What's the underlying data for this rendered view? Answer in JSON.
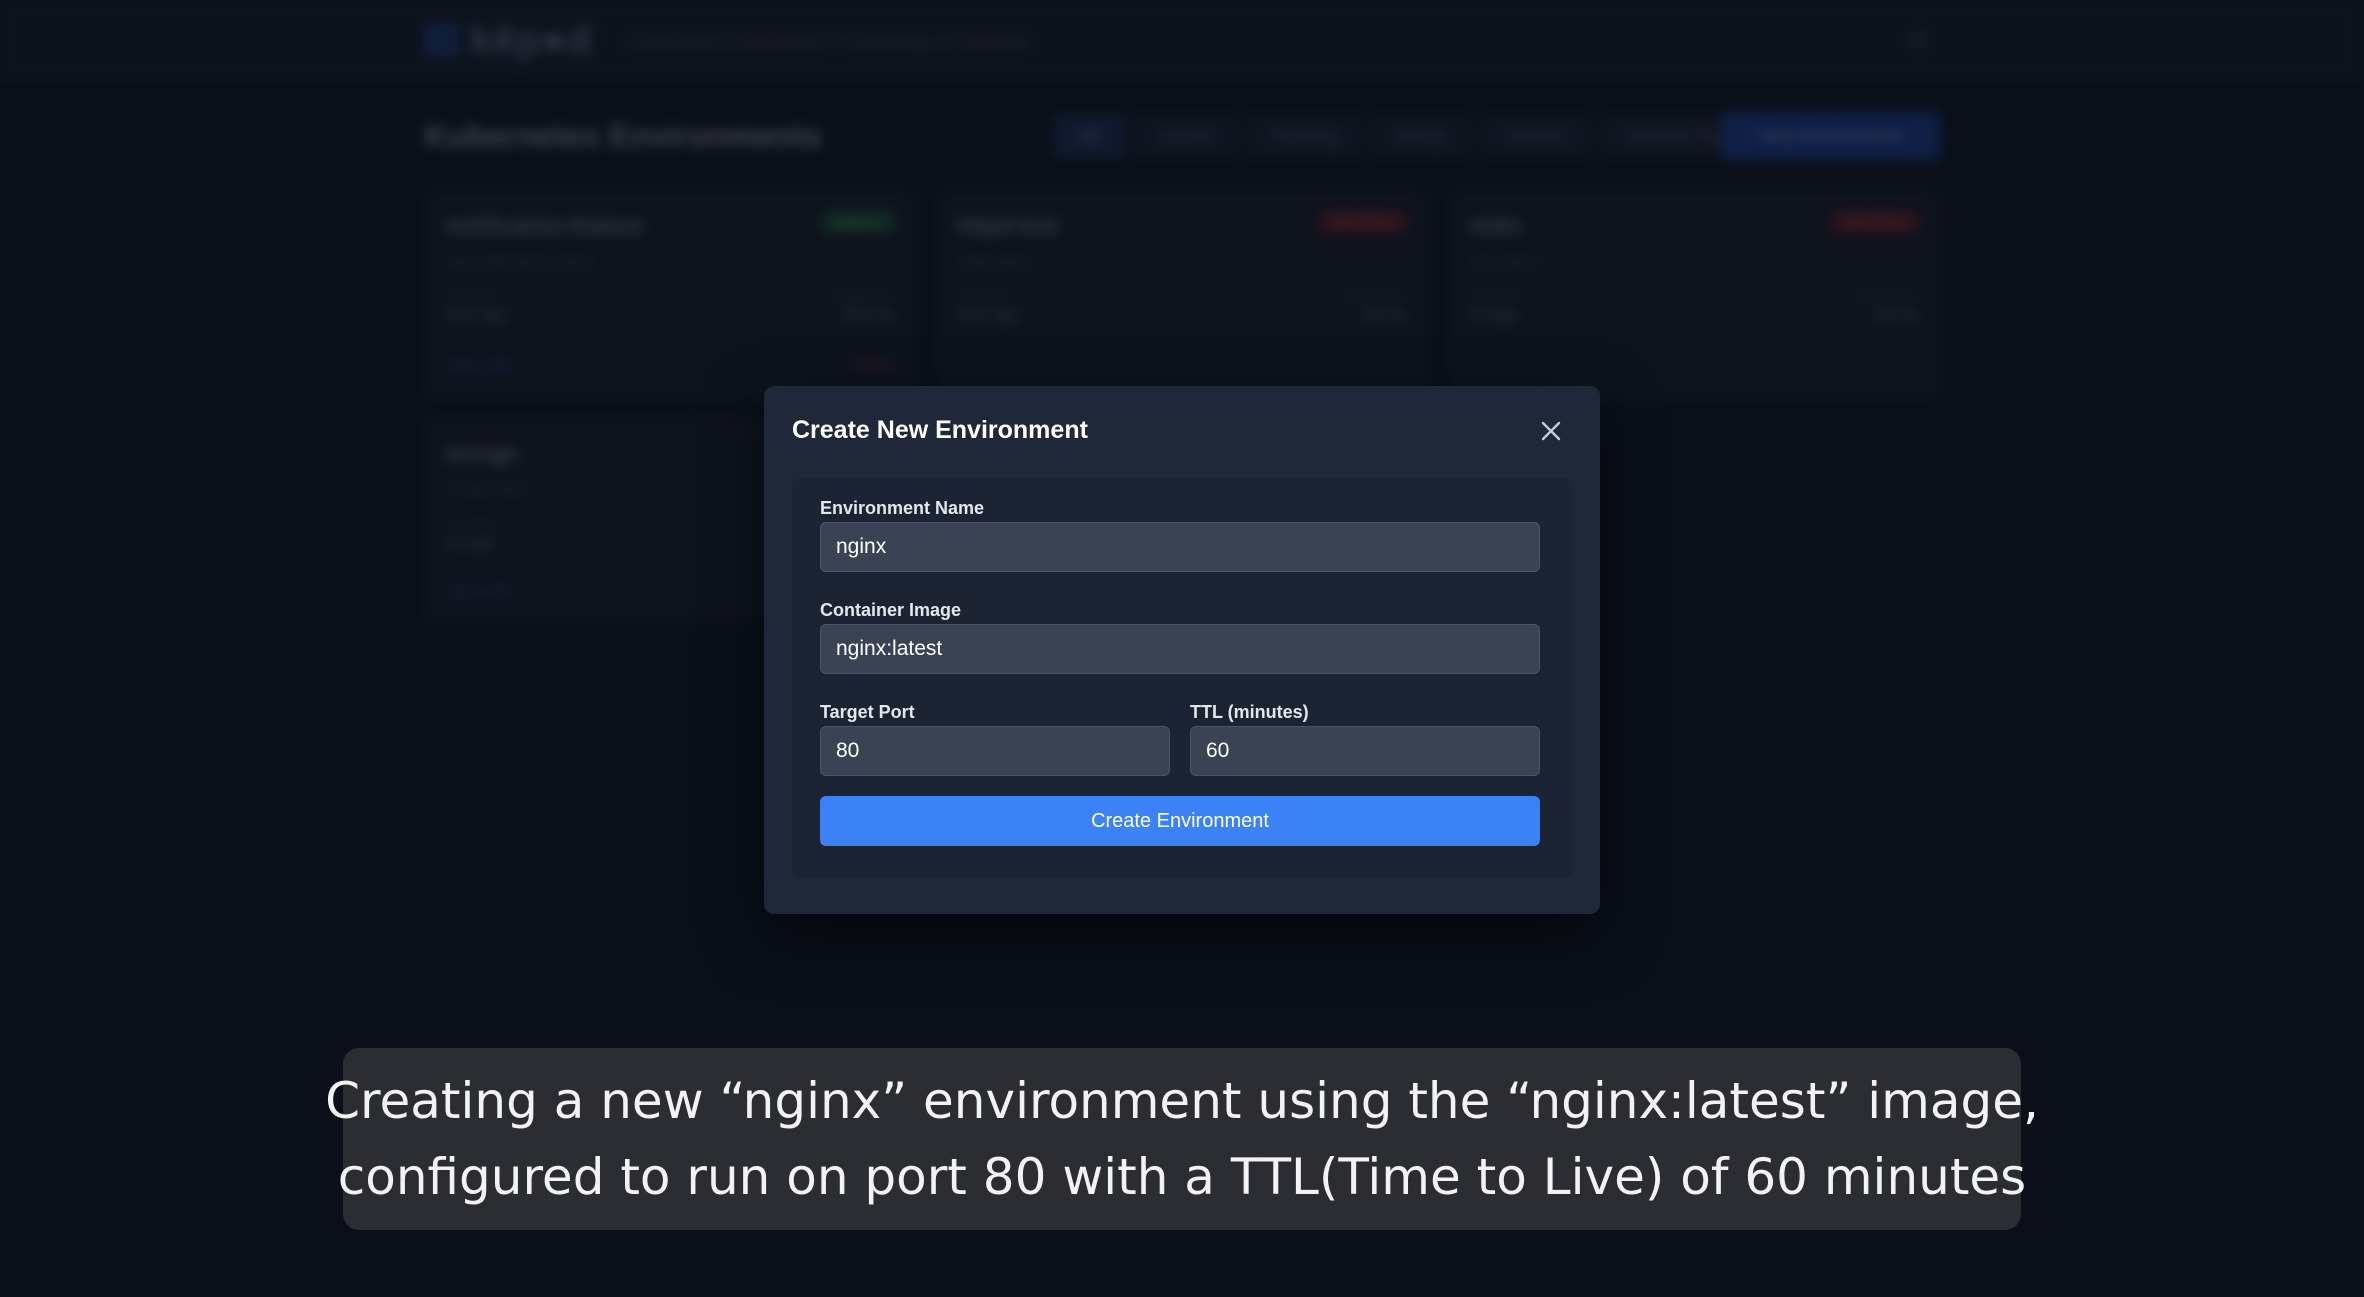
{
  "app": {
    "logo": "kēp●d",
    "tagline": "Kubernetes Environment Provisioning on Demand"
  },
  "page": {
    "title": "Kubernetes Environments",
    "filters": [
      "All",
      "Scaled",
      "Pending",
      "Ready",
      "Deleted"
    ],
    "network_pod_label": "Network Pod",
    "new_environment_label": "New Environment"
  },
  "cards": [
    {
      "title": "notification-feature",
      "subtitle": "app-notifications:latest",
      "status": "READY",
      "created_label": "Created",
      "created": "15m ago",
      "expires_label": "Expires in",
      "expires": "45m 0s",
      "link": "Open URL",
      "danger": "Delete"
    },
    {
      "title": "httpd-test",
      "subtitle": "httpd:alpine",
      "status": "DELETED",
      "created_label": "Created",
      "created": "22m ago",
      "expires_label": "Expired in",
      "expires": "0m 0s"
    },
    {
      "title": "redis",
      "subtitle": "redis:latest",
      "status": "DELETED",
      "created_label": "Created",
      "created": "1h ago",
      "expires_label": "Expired in",
      "expires": "0m 0s"
    },
    {
      "title": "mongo",
      "subtitle": "mongo:latest",
      "created_label": "Created",
      "created": "1h ago",
      "link": "Open URL"
    }
  ],
  "modal": {
    "title": "Create New Environment",
    "fields": {
      "env_name": {
        "label": "Environment Name",
        "value": "nginx"
      },
      "container_image": {
        "label": "Container Image",
        "value": "nginx:latest"
      },
      "target_port": {
        "label": "Target Port",
        "value": "80"
      },
      "ttl": {
        "label": "TTL (minutes)",
        "value": "60"
      }
    },
    "submit_label": "Create Environment"
  },
  "caption": {
    "line1": "Creating a new “nginx” environment using the “nginx:latest” image,",
    "line2": "configured to run on port 80 with a TTL(Time to Live) of 60 minutes"
  },
  "colors": {
    "accent": "#3b82f6",
    "modal_bg": "#1f2838",
    "input_bg": "#394353",
    "page_bg": "#0c121d"
  }
}
